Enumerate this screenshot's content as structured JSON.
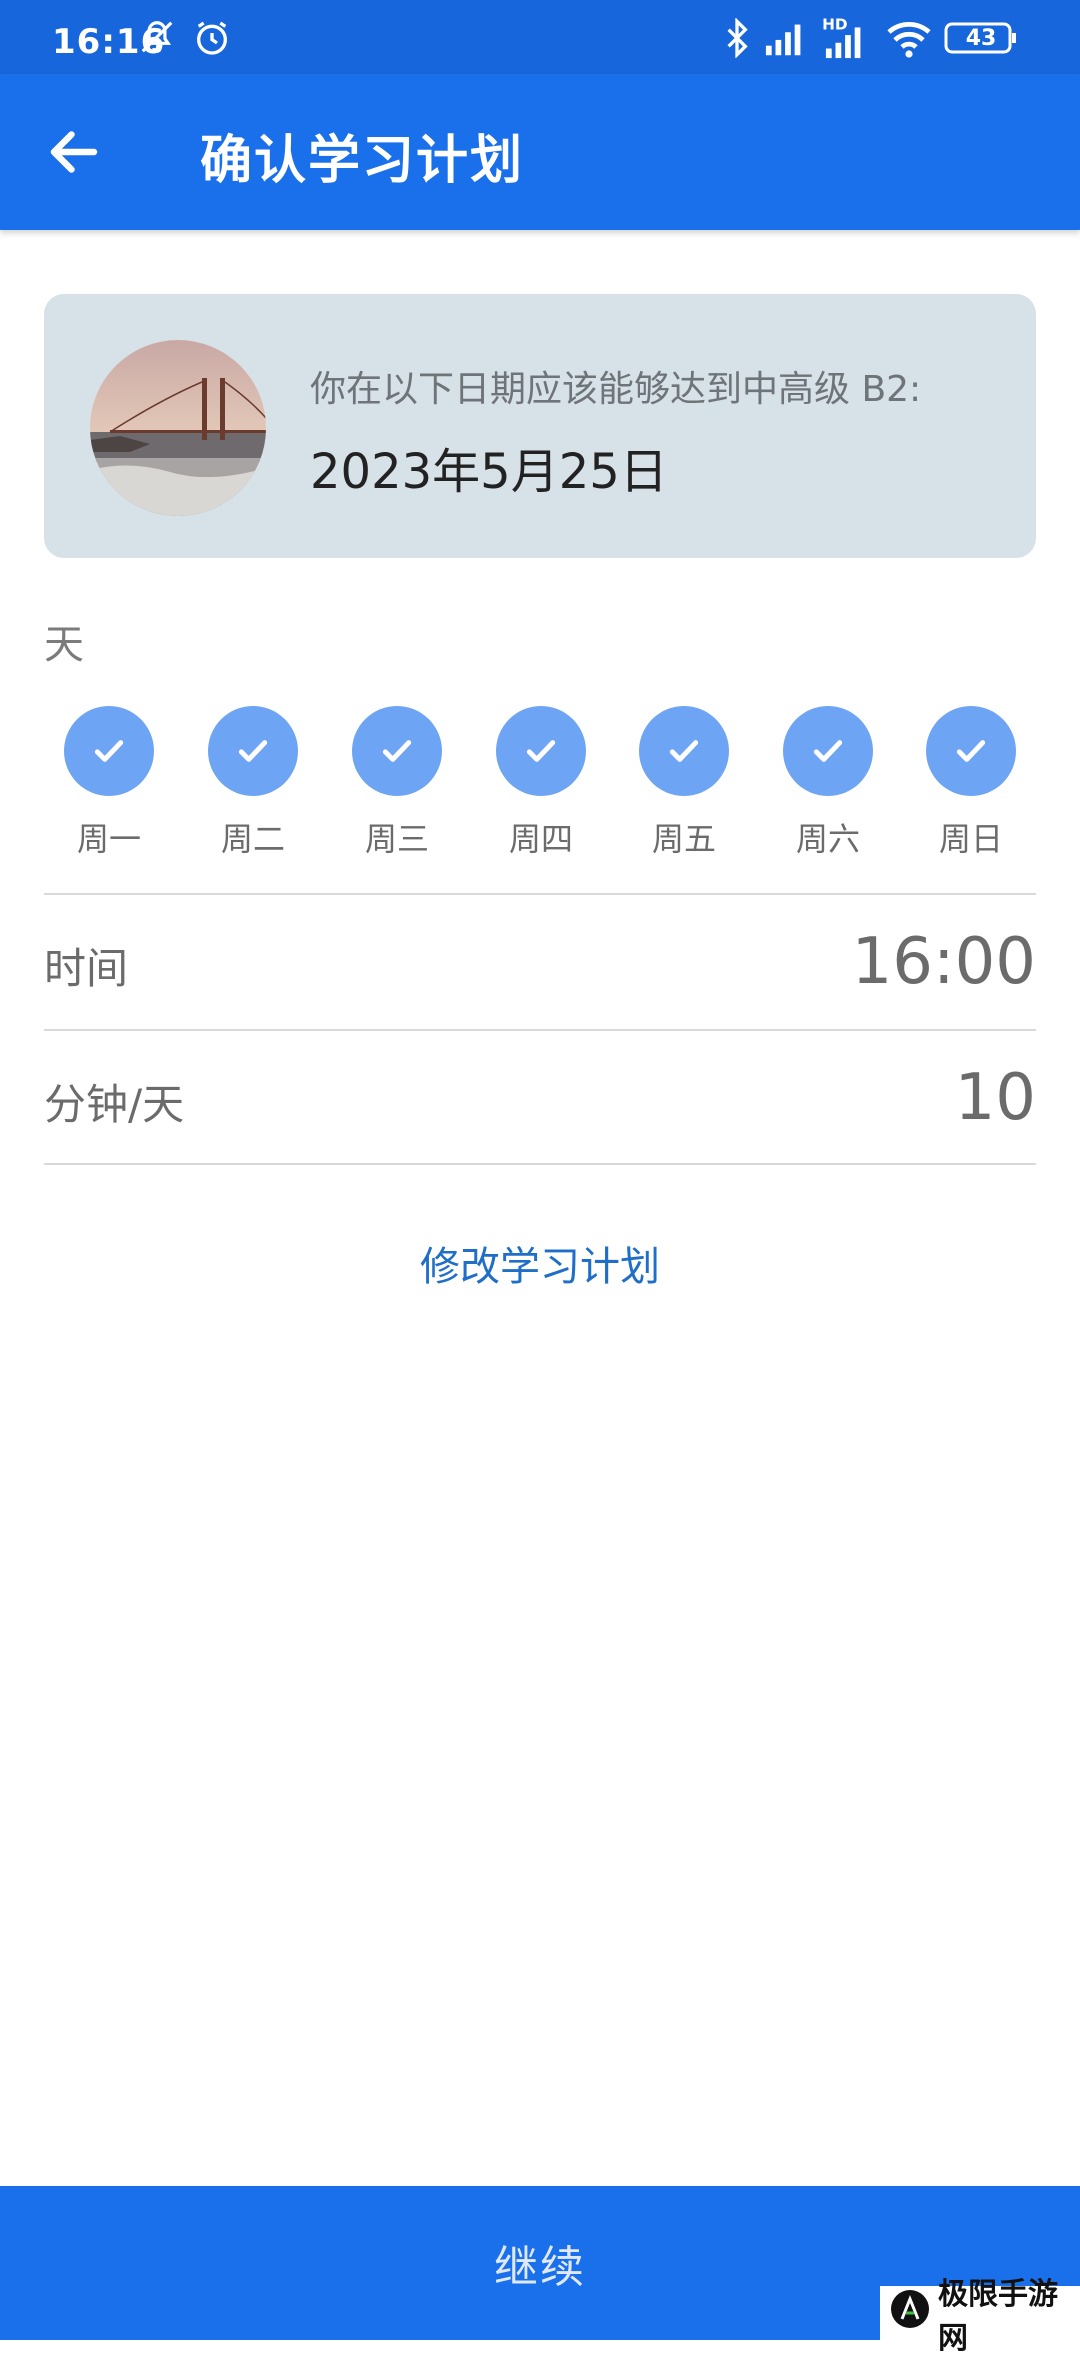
{
  "status_bar": {
    "time": "16:16",
    "battery": "43",
    "icons": [
      "bell-off-icon",
      "alarm-icon",
      "bluetooth-icon",
      "signal-icon",
      "hd-signal-icon",
      "wifi-icon",
      "battery-icon"
    ]
  },
  "app_bar": {
    "back_icon": "arrow-left-icon",
    "title": "确认学习计划"
  },
  "summary_card": {
    "description": "你在以下日期应该能够达到中高级 B2:",
    "target_date": "2023年5月25日"
  },
  "days": {
    "label": "天",
    "items": [
      {
        "label": "周一",
        "checked": true
      },
      {
        "label": "周二",
        "checked": true
      },
      {
        "label": "周三",
        "checked": true
      },
      {
        "label": "周四",
        "checked": true
      },
      {
        "label": "周五",
        "checked": true
      },
      {
        "label": "周六",
        "checked": true
      },
      {
        "label": "周日",
        "checked": true
      }
    ]
  },
  "time_row": {
    "label": "时间",
    "value": "16:00"
  },
  "minutes_row": {
    "label": "分钟/天",
    "value": "10"
  },
  "modify_link": "修改学习计划",
  "continue_button": "继续",
  "watermark": {
    "text": "极限手游网"
  },
  "colors": {
    "primary": "#1a6fea",
    "status_bar": "#1766db",
    "card_bg": "#d7e1e8",
    "day_circle": "#6ea4f4",
    "link": "#1f6fc9"
  }
}
